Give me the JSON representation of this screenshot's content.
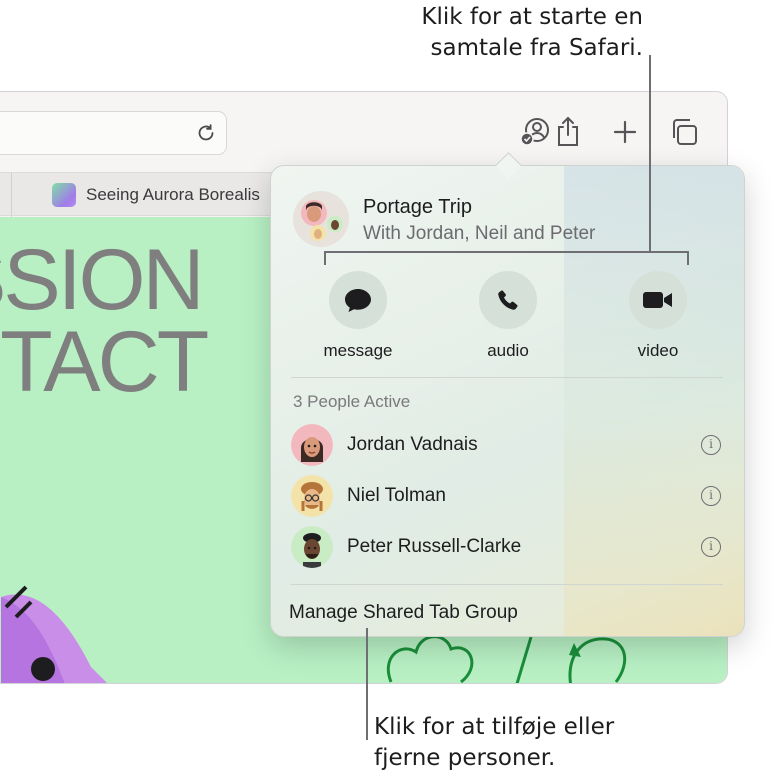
{
  "callouts": {
    "top": [
      "Klik for at starte en",
      "samtale fra Safari."
    ],
    "bottom": [
      "Klik for at tilføje eller",
      "fjerne personer."
    ]
  },
  "browser": {
    "tab_title": "Seeing Aurora Borealis",
    "hero_lines": [
      "SSION",
      "NTACT"
    ],
    "toolbar_icons": [
      "share-conversation-icon",
      "share-icon",
      "new-tab-icon",
      "tab-overview-icon"
    ]
  },
  "popover": {
    "group_title": "Portage Trip",
    "group_subtitle": "With Jordan, Neil and Peter",
    "actions": [
      {
        "label": "message",
        "icon": "speech-bubble-icon"
      },
      {
        "label": "audio",
        "icon": "phone-icon"
      },
      {
        "label": "video",
        "icon": "video-camera-icon"
      }
    ],
    "people_header": "3 People Active",
    "people": [
      {
        "name": "Jordan Vadnais",
        "avatar_bg": "#f2b8be"
      },
      {
        "name": "Niel Tolman",
        "avatar_bg": "#f4e3a8"
      },
      {
        "name": "Peter Russell-Clarke",
        "avatar_bg": "#c9ecc5"
      }
    ],
    "manage_label": "Manage Shared Tab Group"
  },
  "colors": {
    "page_background": "#b8f0c4",
    "hero_text": "#7f7f80"
  }
}
